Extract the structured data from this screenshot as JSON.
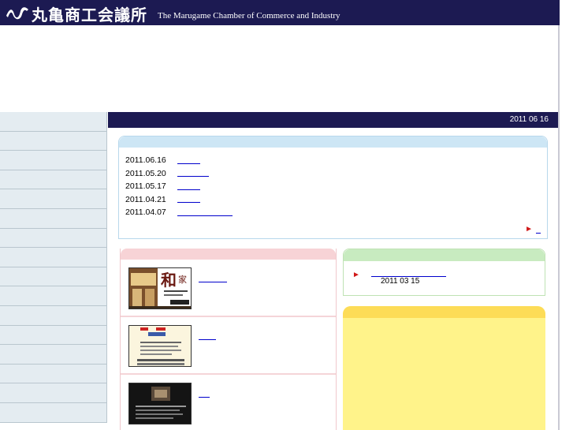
{
  "header": {
    "logo_jp": "丸亀商工会議所",
    "logo_en": "The Marugame Chamber of Commerce and Industry",
    "logo_icon": "wave-logo-icon"
  },
  "datebar": {
    "date": "2011 06 16"
  },
  "news": {
    "items": [
      {
        "date": "2011.06.16"
      },
      {
        "date": "2011.05.20"
      },
      {
        "date": "2011.05.17"
      },
      {
        "date": "2011.04.21"
      },
      {
        "date": "2011.04.07"
      }
    ],
    "more_icon": "red-arrow-icon"
  },
  "right_box": {
    "arrow_icon": "red-arrow-icon",
    "date": "2011 03 15"
  },
  "promo_images": [
    {
      "sign": "和",
      "sign2": "家"
    }
  ],
  "colors": {
    "header_bg": "#1c1a52",
    "sidebar_bg": "#e4ecf1",
    "news_head": "#cde6f5",
    "pink_head": "#f7d3d6",
    "green_head": "#c8ebc0",
    "yellow_bg": "#fff38a",
    "link": "#0000cc"
  }
}
